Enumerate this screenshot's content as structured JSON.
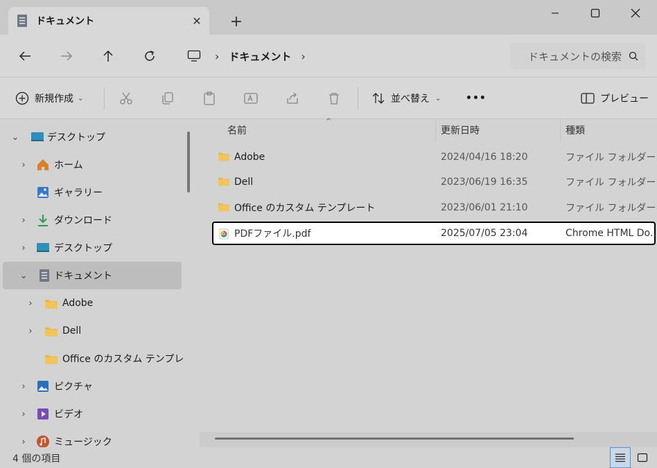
{
  "window": {
    "tab_title": "ドキュメント",
    "tab_close": "✕",
    "new_tab": "+"
  },
  "nav": {
    "breadcrumb": "ドキュメント",
    "search_placeholder": "ドキュメントの検索"
  },
  "toolbar": {
    "new_label": "新規作成",
    "sort_label": "並べ替え",
    "more_label": "•••",
    "preview_label": "プレビュー"
  },
  "sidebar": {
    "items": [
      {
        "label": "デスクトップ",
        "icon": "desktop-icon",
        "expanded": true
      },
      {
        "label": "ホーム",
        "icon": "home-icon"
      },
      {
        "label": "ギャラリー",
        "icon": "gallery-icon"
      },
      {
        "label": "ダウンロード",
        "icon": "download-icon"
      },
      {
        "label": "デスクトップ",
        "icon": "desktop-icon"
      },
      {
        "label": "ドキュメント",
        "icon": "documents-icon",
        "expanded": true,
        "selected": true
      },
      {
        "label": "Adobe",
        "icon": "folder-icon"
      },
      {
        "label": "Dell",
        "icon": "folder-icon"
      },
      {
        "label": "Office のカスタム テンプレート",
        "icon": "folder-icon"
      },
      {
        "label": "ピクチャ",
        "icon": "pictures-icon"
      },
      {
        "label": "ビデオ",
        "icon": "videos-icon"
      },
      {
        "label": "ミュージック",
        "icon": "music-icon"
      }
    ]
  },
  "columns": {
    "name": "名前",
    "modified": "更新日時",
    "type": "種類"
  },
  "files": [
    {
      "name": "Adobe",
      "modified": "2024/04/16 18:20",
      "type": "ファイル フォルダー",
      "icon": "folder-icon"
    },
    {
      "name": "Dell",
      "modified": "2023/06/19 16:35",
      "type": "ファイル フォルダー",
      "icon": "folder-icon"
    },
    {
      "name": "Office のカスタム テンプレート",
      "modified": "2023/06/01 21:10",
      "type": "ファイル フォルダー",
      "icon": "folder-icon"
    },
    {
      "name": "PDFファイル.pdf",
      "modified": "2025/07/05 23:04",
      "type": "Chrome HTML Do...",
      "icon": "chrome-pdf-icon",
      "highlighted": true
    }
  ],
  "status": {
    "item_count": "4 個の項目"
  },
  "colors": {
    "folder": "#e8b64a",
    "highlight_border": "#000000",
    "view_active": "#5a8fd0"
  }
}
